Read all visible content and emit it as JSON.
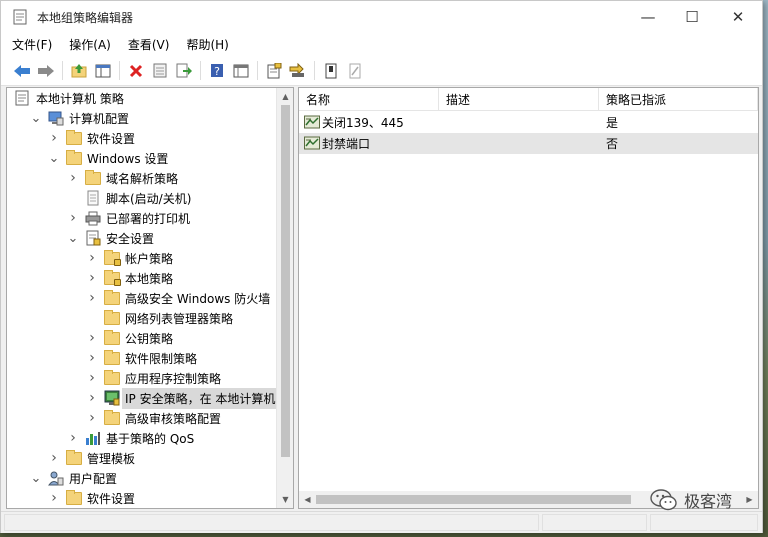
{
  "window": {
    "title": "本地组策略编辑器",
    "controls": {
      "minimize": "—",
      "maximize": "☐",
      "close": "✕"
    }
  },
  "menu": [
    "文件(F)",
    "操作(A)",
    "查看(V)",
    "帮助(H)"
  ],
  "toolbar": [
    "back-icon",
    "forward-icon",
    "up-folder-icon",
    "show-hide-tree-icon",
    "delete-icon",
    "properties-icon",
    "export-icon",
    "help-icon",
    "view-icon",
    "ip-filter-icon",
    "add-icon",
    "assign-icon",
    "unassign-icon"
  ],
  "tree": {
    "items": [
      {
        "label": "本地计算机 策略",
        "level": 0,
        "expander": "",
        "icon": "policy-doc-icon"
      },
      {
        "label": "计算机配置",
        "level": 1,
        "expander": "open",
        "icon": "computer-icon"
      },
      {
        "label": "软件设置",
        "level": 2,
        "expander": "closed",
        "icon": "folder-icon"
      },
      {
        "label": "Windows 设置",
        "level": 2,
        "expander": "open",
        "icon": "folder-icon"
      },
      {
        "label": "域名解析策略",
        "level": 3,
        "expander": "closed",
        "icon": "folder-icon"
      },
      {
        "label": "脚本(启动/关机)",
        "level": 3,
        "expander": "",
        "icon": "script-icon"
      },
      {
        "label": "已部署的打印机",
        "level": 3,
        "expander": "closed",
        "icon": "printer-icon"
      },
      {
        "label": "安全设置",
        "level": 3,
        "expander": "open",
        "icon": "security-icon"
      },
      {
        "label": "帐户策略",
        "level": 4,
        "expander": "closed",
        "icon": "folder-lock-icon"
      },
      {
        "label": "本地策略",
        "level": 4,
        "expander": "closed",
        "icon": "folder-lock-icon"
      },
      {
        "label": "高级安全 Windows 防火墙",
        "level": 4,
        "expander": "closed",
        "icon": "folder-icon"
      },
      {
        "label": "网络列表管理器策略",
        "level": 4,
        "expander": "",
        "icon": "folder-icon"
      },
      {
        "label": "公钥策略",
        "level": 4,
        "expander": "closed",
        "icon": "folder-icon"
      },
      {
        "label": "软件限制策略",
        "level": 4,
        "expander": "closed",
        "icon": "folder-icon"
      },
      {
        "label": "应用程序控制策略",
        "level": 4,
        "expander": "closed",
        "icon": "folder-icon"
      },
      {
        "label": "IP 安全策略，在 本地计算机",
        "level": 4,
        "expander": "closed",
        "icon": "ip-security-icon",
        "selected": true
      },
      {
        "label": "高级审核策略配置",
        "level": 4,
        "expander": "closed",
        "icon": "folder-icon"
      },
      {
        "label": "基于策略的 QoS",
        "level": 3,
        "expander": "closed",
        "icon": "qos-chart-icon"
      },
      {
        "label": "管理模板",
        "level": 2,
        "expander": "closed",
        "icon": "folder-icon"
      },
      {
        "label": "用户配置",
        "level": 1,
        "expander": "open",
        "icon": "user-icon"
      },
      {
        "label": "软件设置",
        "level": 2,
        "expander": "closed",
        "icon": "folder-icon"
      }
    ]
  },
  "list": {
    "columns": [
      "名称",
      "描述",
      "策略已指派"
    ],
    "sort_indicator": "^",
    "rows": [
      {
        "name": "关闭139、445",
        "description": "",
        "assigned": "是",
        "selected": false
      },
      {
        "name": "封禁端口",
        "description": "",
        "assigned": "否",
        "selected": true
      }
    ]
  },
  "watermark": {
    "text": "极客湾"
  },
  "colors": {
    "selection": "#d9d9d9",
    "row_selected": "#e5e5e5",
    "scroll_thumb": "#c2c2c2"
  }
}
